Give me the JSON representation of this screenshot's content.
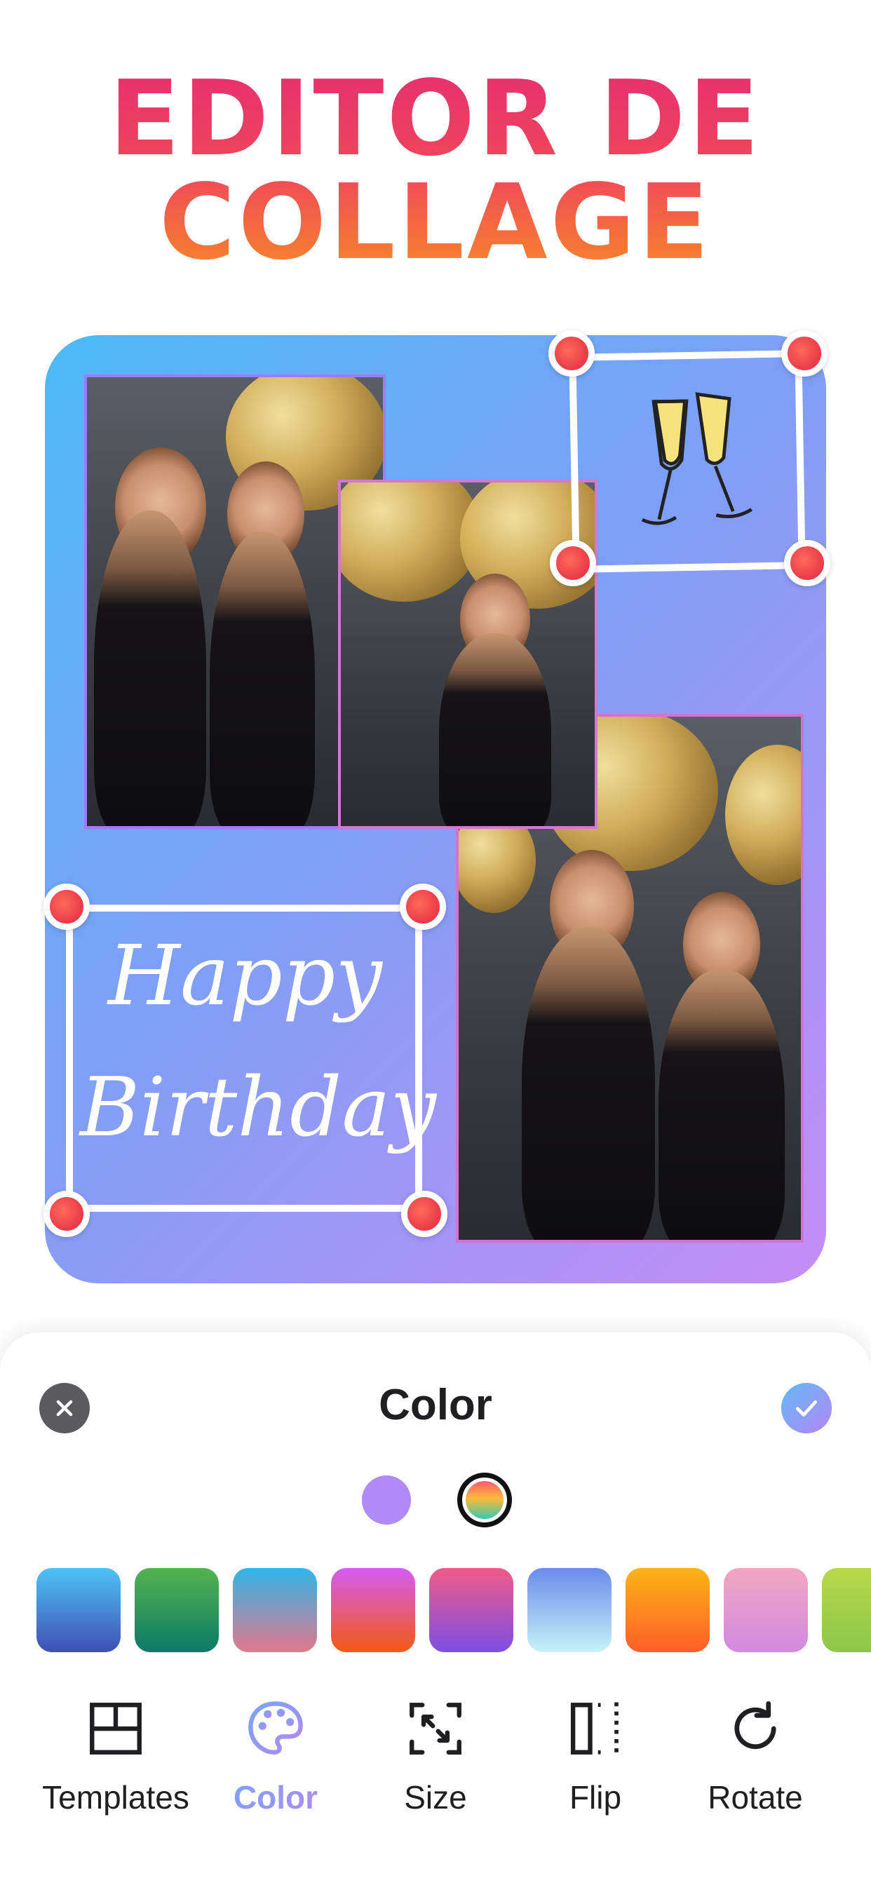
{
  "header": {
    "title_line1": "EDITOR DE",
    "title_line2": "COLLAGE"
  },
  "collage": {
    "sticker_text_line1": "Happy",
    "sticker_text_line2": "Birthday",
    "sticker_icon": "champagne-glasses-icon"
  },
  "panel": {
    "title": "Color",
    "close_icon": "close-icon",
    "confirm_icon": "check-icon",
    "modes": [
      "solid",
      "gradient"
    ],
    "selected_mode": "gradient",
    "swatches": [
      {
        "from": "#4fc3f7",
        "to": "#3f4fb4"
      },
      {
        "from": "#53b34f",
        "to": "#0d7a68"
      },
      {
        "from": "#2fb5e8",
        "to": "#e3788c"
      },
      {
        "from": "#d55cf3",
        "to": "#f25a10"
      },
      {
        "from": "#f05b88",
        "to": "#7d4fe4"
      },
      {
        "from": "#6b8be9",
        "to": "#c7f2f8"
      },
      {
        "from": "#fbb417",
        "to": "#ff5e29"
      },
      {
        "from": "#f2a6c0",
        "to": "#d18ae0"
      },
      {
        "from": "#b7d94b",
        "to": "#8cc64a"
      }
    ]
  },
  "toolbar": {
    "items": [
      {
        "label": "Templates",
        "icon": "templates-icon"
      },
      {
        "label": "Color",
        "icon": "palette-icon"
      },
      {
        "label": "Size",
        "icon": "resize-icon"
      },
      {
        "label": "Flip",
        "icon": "flip-icon"
      },
      {
        "label": "Rotate",
        "icon": "rotate-icon"
      }
    ],
    "active": "Color"
  }
}
